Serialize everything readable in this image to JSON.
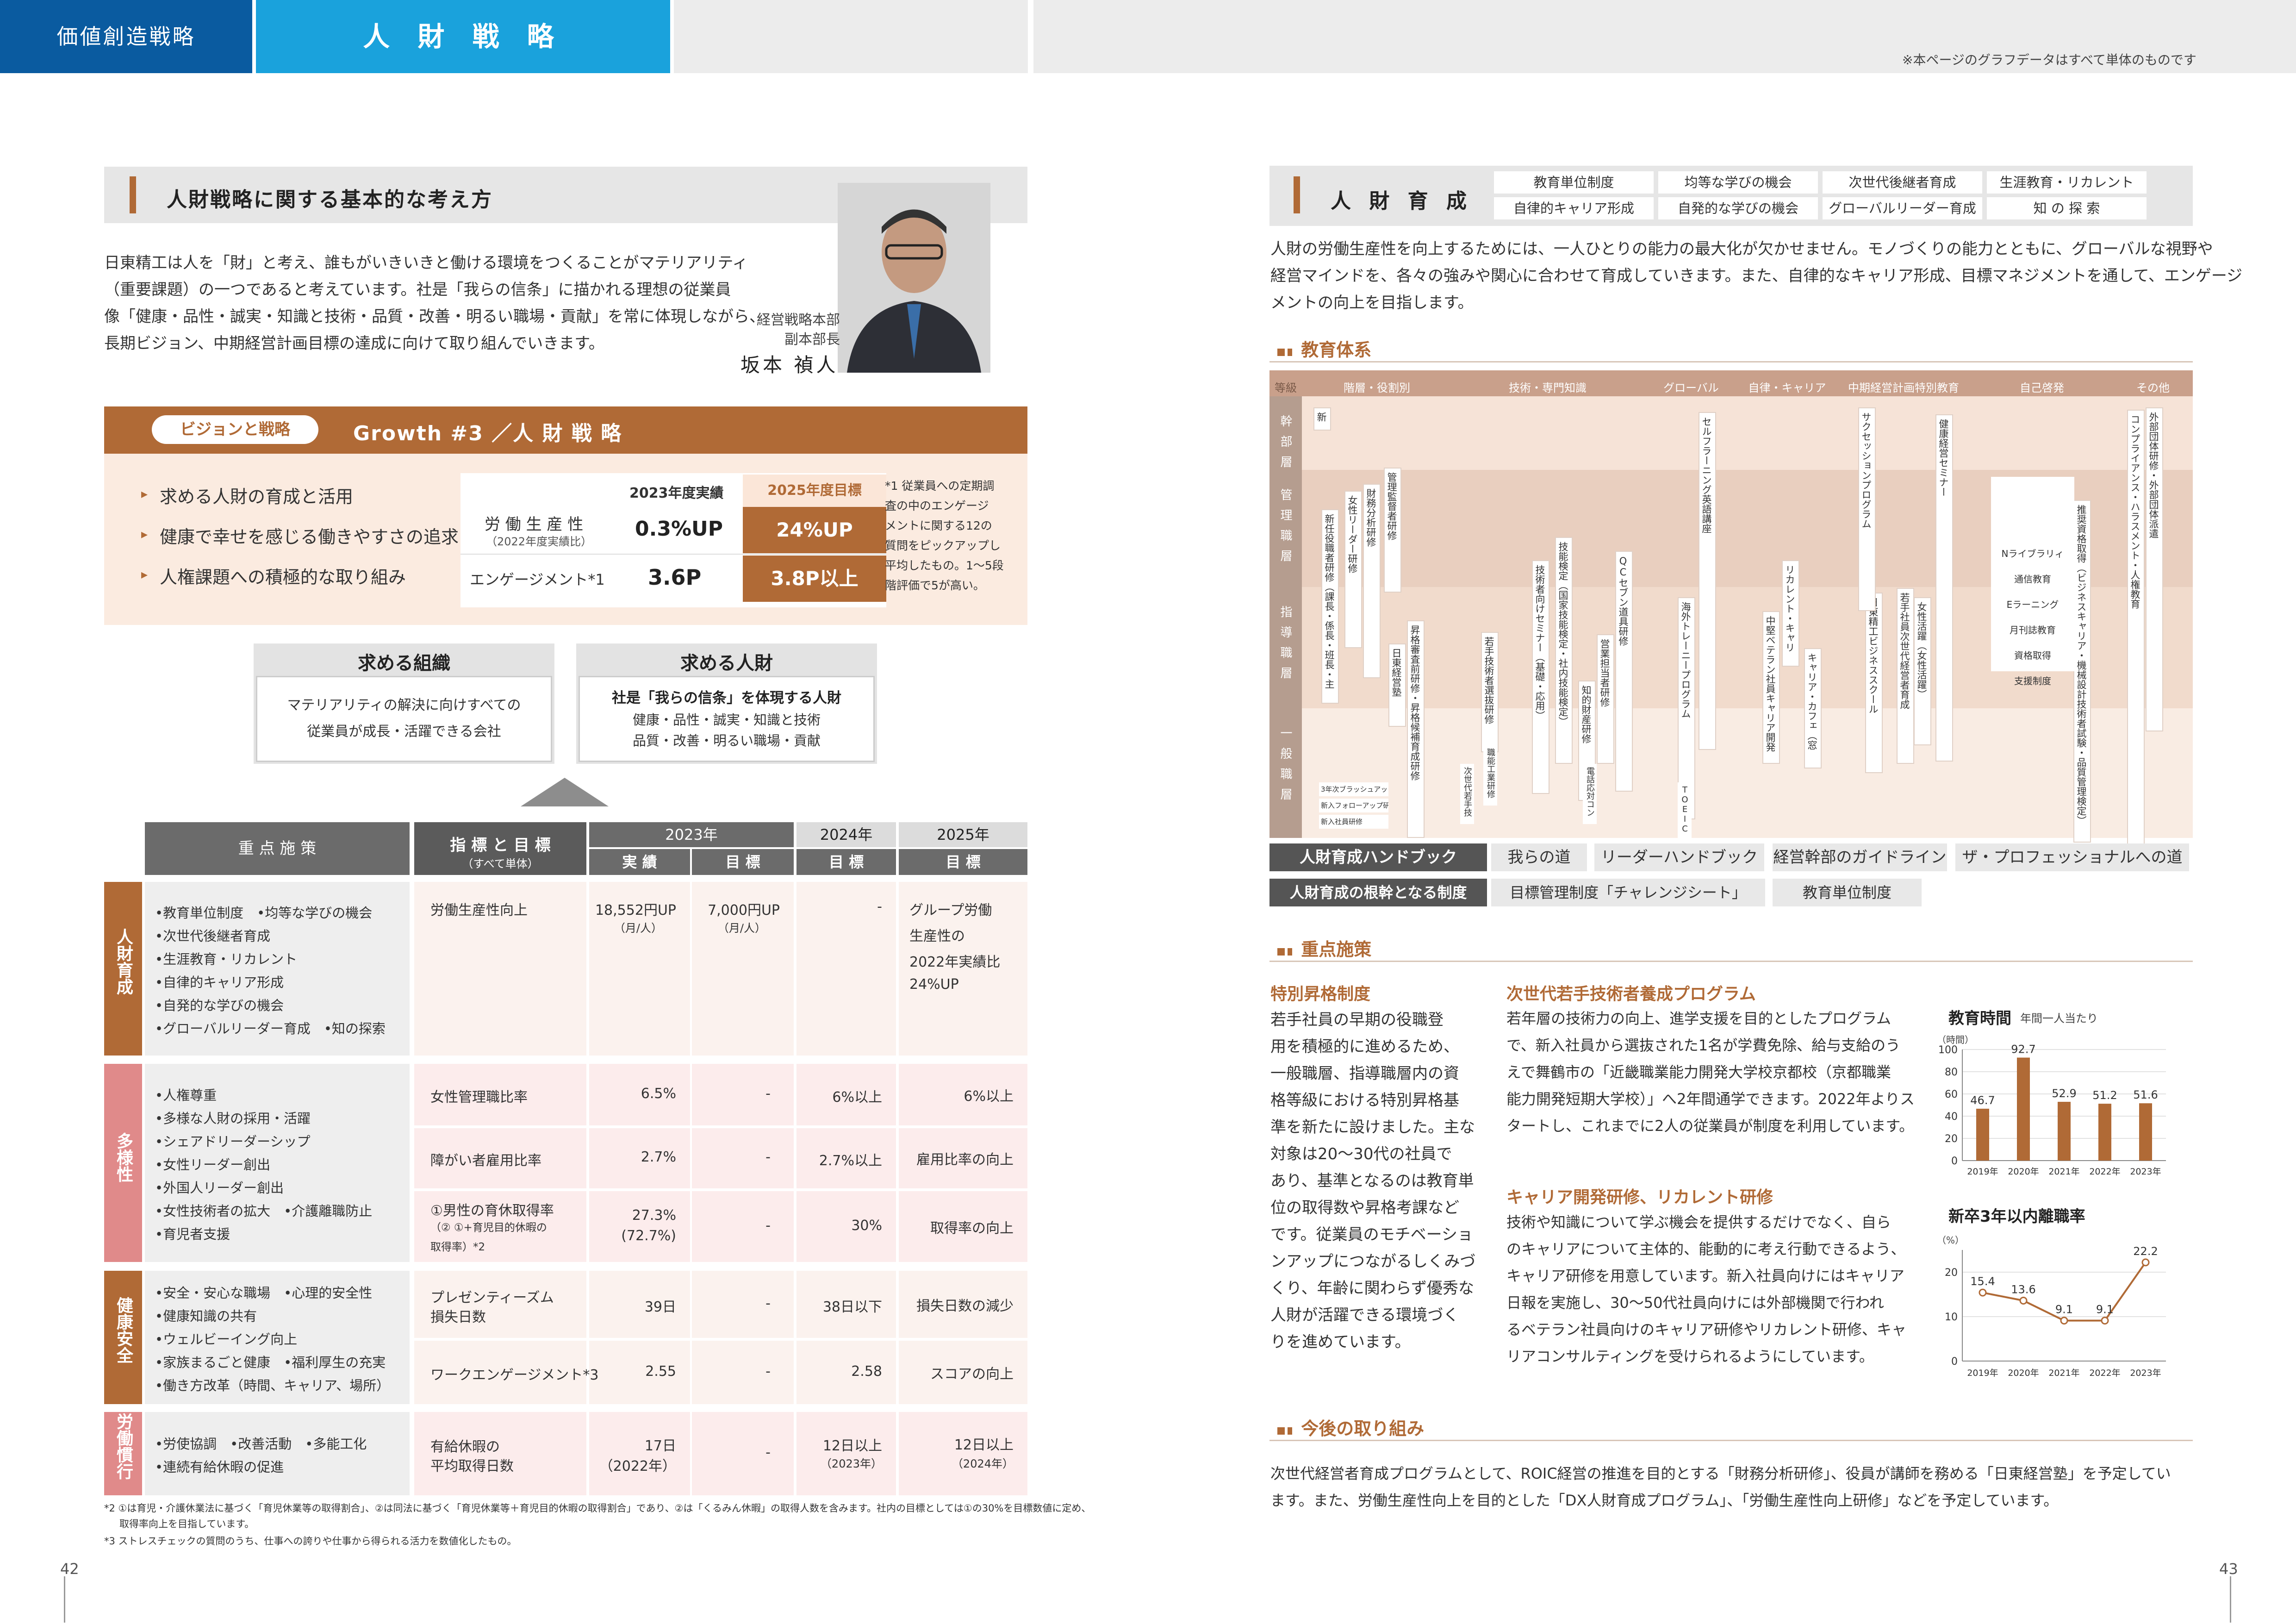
{
  "header": {
    "left_tab": "価値創造戦略",
    "main_tab": "人 財 戦 略",
    "note": "※本ページのグラフデータはすべて単体のものです"
  },
  "basic": {
    "title": "人財戦略に関する基本的な考え方",
    "lines": [
      "日東精工は人を「財」と考え、誰もがいきいきと働ける環境をつくることがマテリアリティ",
      "（重要課題）の一つであると考えています。社是「我らの信条」に描かれる理想の従業員",
      "像「健康・品性・誠実・知識と技術・品質・改善・明るい職場・貢献」を常に体現しながら、",
      "長期ビジョン、中期経営計画目標の達成に向けて取り組んでいきます。"
    ],
    "role1": "経営戦略本部",
    "role2": "副本部長",
    "name": "坂本 禎人"
  },
  "vision": {
    "badge": "ビジョンと戦略",
    "title": "Growth #3 ／人 財 戦 略",
    "bullets": [
      "求める人財の育成と活用",
      "健康で幸せを感じる働きやすさの追求",
      "人権課題への積極的な取り組み"
    ],
    "col1": "2023年度実績",
    "col2": "2025年度目標",
    "r1label": "労 働 生 産 性",
    "r1sub": "（2022年度実績比）",
    "r1v1": "0.3%UP",
    "r1v2": "24%UP",
    "r2label": "エンゲージメント*1",
    "r2v1": "3.6P",
    "r2v2": "3.8P以上",
    "fn": [
      "*1 従業員への定期調",
      "査の中のエンゲージ",
      "メントに関する12の",
      "質問をピックアップし",
      "平均したもの。1～5段",
      "階評価で5が高い。"
    ]
  },
  "org": {
    "t1": "求める組織",
    "d1a": "マテリアリティの解決に向けすべての",
    "d1b": "従業員が成長・活躍できる会社",
    "t2": "求める人財",
    "d2a": "社是「我らの信条」を体現する人財",
    "d2b": "健康・品性・誠実・知識と技術",
    "d2c": "品質・改善・明るい職場・貢献"
  },
  "kpi": {
    "h_measure": "重 点 施 策",
    "h_index": "指 標 と 目 標",
    "h_index_sub": "（すべて単体）",
    "h_2023": "2023年",
    "h_2024": "2024年",
    "h_2025": "2025年",
    "h_actual": "実 績",
    "h_target": "目 標",
    "sections": [
      {
        "name": "人財育成",
        "items": [
          "•教育単位制度　•均等な学びの機会",
          "•次世代後継者育成",
          "•生涯教育・リカレント",
          "•自律的キャリア形成",
          "•自発的な学びの機会",
          "•グローバルリーダー育成　•知の探索"
        ]
      },
      {
        "name": "多様性",
        "items": [
          "•人権尊重",
          "•多様な人財の採用・活躍",
          "•シェアドリーダーシップ",
          "•女性リーダー創出",
          "•外国人リーダー創出",
          "•女性技術者の拡大　•介護離職防止",
          "•育児者支援"
        ]
      },
      {
        "name": "健康安全",
        "items": [
          "•安全・安心な職場　•心理的安全性",
          "•健康知識の共有",
          "•ウェルビーイング向上",
          "•家族まるごと健康　•福利厚生の充実",
          "•働き方改革（時間、キャリア、場所）"
        ]
      },
      {
        "name": "労働慣行",
        "items": [
          "•労使協調　•改善活動　•多能工化",
          "•連続有給休暇の促進"
        ]
      }
    ],
    "rows": [
      {
        "label": "労働生産性向上",
        "a": "18,552円UP",
        "a2": "（月/人）",
        "t": "7,000円UP",
        "t2": "（月/人）",
        "y24": "-",
        "y25": [
          "グループ労働",
          "生産性の",
          "2022年実績比",
          "24%UP"
        ]
      },
      {
        "label": "女性管理職比率",
        "a": "6.5%",
        "t": "-",
        "y24": "6%以上",
        "y25": [
          "6%以上"
        ]
      },
      {
        "label": "障がい者雇用比率",
        "a": "2.7%",
        "t": "-",
        "y24": "2.7%以上",
        "y25": [
          "雇用比率の向上"
        ]
      },
      {
        "label": "①男性の育休取得率",
        "label2": "（② ①+育児目的休暇の",
        "label3": "取得率）*2",
        "a": "27.3%",
        "a2": "(72.7%)",
        "t": "-",
        "y24": "30%",
        "y25": [
          "取得率の向上"
        ]
      },
      {
        "label": "プレゼンティーズム",
        "label2": "損失日数",
        "a": "39日",
        "t": "-",
        "y24": "38日以下",
        "y25": [
          "損失日数の減少"
        ]
      },
      {
        "label": "ワークエンゲージメント*3",
        "a": "2.55",
        "t": "-",
        "y24": "2.58",
        "y25": [
          "スコアの向上"
        ]
      },
      {
        "label": "有給休暇の",
        "label2": "平均取得日数",
        "a": "17日",
        "a2": "（2022年）",
        "t": "-",
        "y24": "12日以上",
        "y24b": "（2023年）",
        "y25": [
          "12日以上",
          "（2024年）"
        ]
      }
    ],
    "fn2": "*2 ①は育児・介護休業法に基づく「育児休業等の取得割合」、②は同法に基づく「育児休業等＋育児目的休暇の取得割合」であり、②は「くるみん休暇」の取得人数を含みます。社内の目標としては①の30%を目標数値に定め、",
    "fn2b": "取得率向上を目指しています。",
    "fn3": "*3 ストレスチェックの質問のうち、仕事への誇りや仕事から得られる活力を数値化したもの。"
  },
  "page_left": "42",
  "page_right": "43",
  "dev": {
    "title": "人 財 育 成",
    "tags": [
      "教育単位制度",
      "均等な学びの機会",
      "次世代後継者育成",
      "生涯教育・リカレント",
      "自律的キャリア形成",
      "自発的な学びの機会",
      "グローバルリーダー育成",
      "知 の 探 索"
    ],
    "lines": [
      "人財の労働生産性を向上するためには、一人ひとりの能力の最大化が欠かせません。モノづくりの能力とともに、グローバルな視野や",
      "経営マインドを、各々の強みや関心に合わせて育成していきます。また、自律的なキャリア形成、目標マネジメントを通して、エンゲージ",
      "メントの向上を目指します。"
    ]
  },
  "edu": {
    "title": "教育体系",
    "heads": [
      "等級",
      "階層・役割別",
      "技術・専門知識",
      "グローバル",
      "自律・キャリア",
      "中期経営計画特別教育",
      "自己啓発",
      "その他"
    ],
    "grades": [
      "幹部層",
      "管理職層",
      "指導職層",
      "一般職層"
    ],
    "cols": [
      "新任幹部研修",
      "新任役職者研修（課長・係長・班長・主任）",
      "女性リーダー研修",
      "財務分析研修",
      "管理監督者研修",
      "日東経営塾",
      "昇格審査前研修・昇格候補育成研修",
      "若手技術者選抜研修",
      "技術者向けセミナー（基礎・応用）",
      "技能検定（国家技能検定・社内技能検定）",
      "知的財産研修",
      "営業担当者研修",
      "QCセブン道具研修",
      "セルフラーニング英語講座",
      "海外トレーニープログラム",
      "リカレント・キャリア教育",
      "中堅ベテラン社員キャリア開発研修",
      "キャリア・カフェ（窓口）",
      "日東精工ビジネススクール",
      "若手社員次世代経営者育成",
      "女性活躍（女性活躍）",
      "健康経営セミナー",
      "サクセッションプログラム",
      "推奨資格取得（ビジネスキャリア・機械設計技術者試験・品質管理検定）",
      "コンプライアンス・ハラスメント・人権教育",
      "外部団体研修・外部団体派遣"
    ],
    "self": [
      "Nライブラリィ",
      "通信教育",
      "Eラーニング",
      "月刊誌教育",
      "資格取得",
      "支援制度"
    ],
    "small": [
      "3年次ブラッシュアップ研修",
      "新入フォローアップ研修",
      "新入社員研修",
      "次世代若手技術者育成プログラム",
      "職能工業研修",
      "電話応対コンクール",
      "TOEIC"
    ],
    "hb_label": "人財育成ハンドブック",
    "hb": [
      "我らの道",
      "リーダーハンドブック",
      "経営幹部のガイドライン",
      "ザ・プロフェッショナルへの道"
    ],
    "base_label": "人財育成の根幹となる制度",
    "base": [
      "目標管理制度「チャレンジシート」",
      "教育単位制度"
    ]
  },
  "focus": {
    "title": "重点施策",
    "t1": "特別昇格制度",
    "p1": [
      "若手社員の早期の役職登",
      "用を積極的に進めるため、",
      "一般職層、指導職層内の資",
      "格等級における特別昇格基",
      "準を新たに設けました。主な",
      "対象は20～30代の社員で",
      "あり、基準となるのは教育単",
      "位の取得数や昇格考課など",
      "です。従業員のモチベーショ",
      "ンアップにつながるしくみづ",
      "くり、年齢に関わらず優秀な",
      "人財が活躍できる環境づく",
      "りを進めています。"
    ],
    "t2": "次世代若手技術者養成プログラム",
    "p2": [
      "若年層の技術力の向上、進学支援を目的としたプログラム",
      "で、新入社員から選抜された1名が学費免除、給与支給のう",
      "えで舞鶴市の「近畿職業能力開発大学校京都校（京都職業",
      "能力開発短期大学校）」へ2年間通学できます。2022年よりス",
      "タートし、これまでに2人の従業員が制度を利用しています。"
    ],
    "t3": "キャリア開発研修、リカレント研修",
    "p3": [
      "技術や知識について学ぶ機会を提供するだけでなく、自ら",
      "のキャリアについて主体的、能動的に考え行動できるよう、",
      "キャリア研修を用意しています。新入社員向けにはキャリア",
      "日報を実施し、30～50代社員向けには外部機関で行われ",
      "るベテラン社員向けのキャリア研修やリカレント研修、キャ",
      "リアコンサルティングを受けられるようにしています。"
    ]
  },
  "future": {
    "title": "今後の取り組み",
    "lines": [
      "次世代経営者育成プログラムとして、ROIC経営の推進を目的とする「財務分析研修」、役員が講師を務める「日東経営塾」を予定してい",
      "ます。また、労働生産性向上を目的とした「DX人財育成プログラム」、「労働生産性向上研修」などを予定しています。"
    ]
  },
  "chart_data": [
    {
      "type": "bar",
      "title": "教育時間",
      "subtitle": "年間一人当たり",
      "ylabel": "（時間）",
      "categories": [
        "2019年",
        "2020年",
        "2021年",
        "2022年",
        "2023年"
      ],
      "values": [
        46.7,
        92.7,
        52.9,
        51.2,
        51.6
      ],
      "ylim": [
        0,
        100
      ],
      "yticks": [
        0,
        20,
        40,
        60,
        80,
        100
      ],
      "color": "#b06a36"
    },
    {
      "type": "line",
      "title": "新卒3年以内離職率",
      "ylabel": "（%）",
      "categories": [
        "2019年",
        "2020年",
        "2021年",
        "2022年",
        "2023年"
      ],
      "values": [
        15.4,
        13.6,
        9.1,
        9.1,
        22.2
      ],
      "ylim": [
        0,
        25
      ],
      "yticks": [
        0,
        10,
        20
      ],
      "color": "#b06a36"
    }
  ]
}
